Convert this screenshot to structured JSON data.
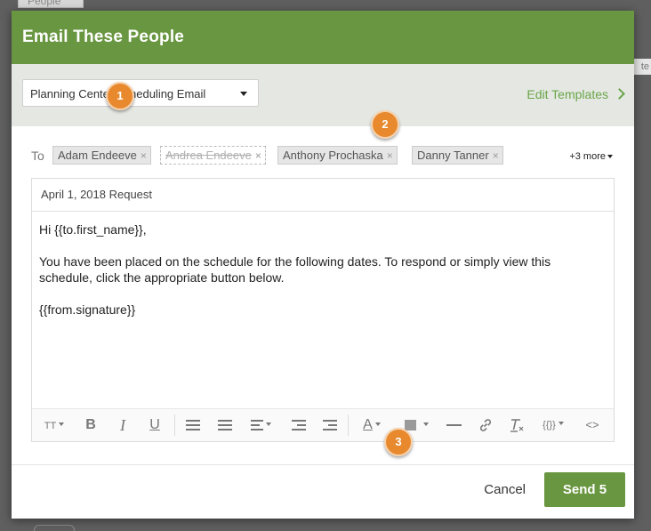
{
  "backdrop": {
    "tab_label": "People",
    "right_fragment": "te"
  },
  "modal": {
    "title": "Email These People"
  },
  "template": {
    "selected": "Planning Center Scheduling Email",
    "edit_label": "Edit Templates"
  },
  "recipients": {
    "to_label": "To",
    "chips": [
      {
        "name": "Adam Endeeve",
        "excluded": false
      },
      {
        "name": "Andrea Endeeve",
        "excluded": true
      },
      {
        "name": "Anthony Prochaska",
        "excluded": false
      },
      {
        "name": "Danny Tanner",
        "excluded": false
      }
    ],
    "remove_glyph": "×",
    "more_label": "+3 more"
  },
  "compose": {
    "subject": "April 1, 2018 Request",
    "body_line1": "Hi {{to.first_name}},",
    "body_line2": "You have been placed on the schedule for the following dates. To respond or simply view this schedule, click the appropriate button below.",
    "body_line3": "{{from.signature}}"
  },
  "toolbar": {
    "font_size": "TT",
    "bold": "B",
    "italic": "I",
    "underline": "U",
    "text_color": "A",
    "variables": "{{}}",
    "code": "<>"
  },
  "footer": {
    "cancel_label": "Cancel",
    "send_label": "Send 5"
  },
  "badges": [
    "1",
    "2",
    "3"
  ],
  "colors": {
    "header_green": "#699640",
    "link_green": "#69a54a",
    "badge_orange": "#e8892e"
  }
}
